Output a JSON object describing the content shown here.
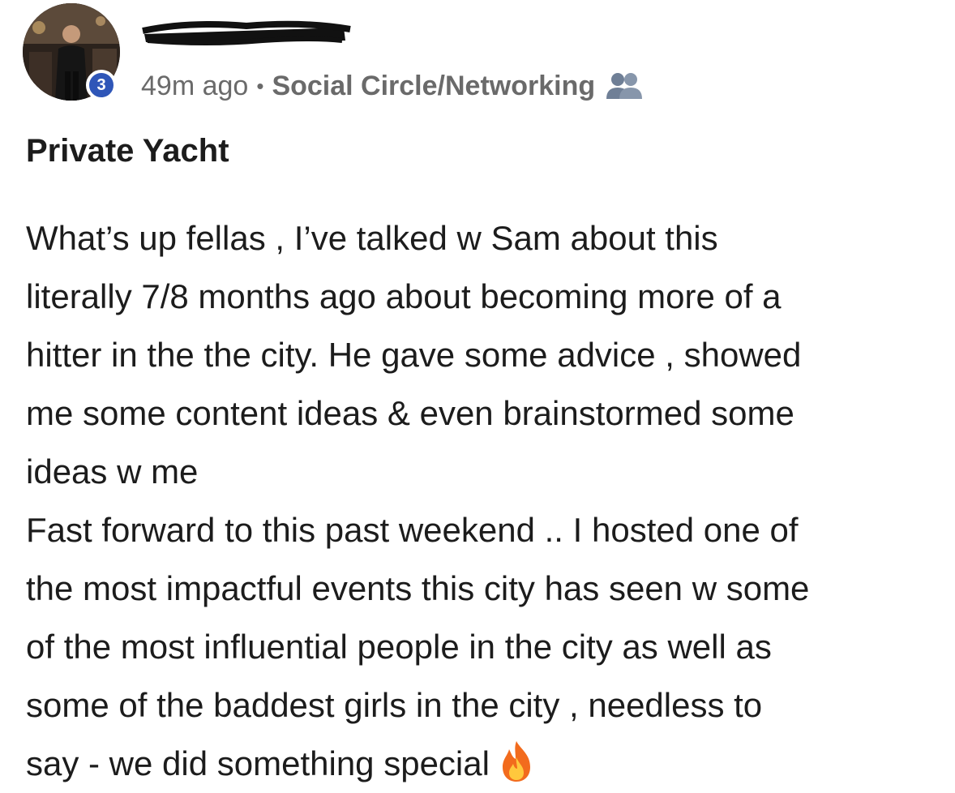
{
  "post": {
    "author": {
      "name_redacted": true,
      "badge_count": "3"
    },
    "meta": {
      "time": "49m ago",
      "separator": "•",
      "category": "Social Circle/Networking",
      "category_icon": "group-icon"
    },
    "title": "Private Yacht",
    "body_lines": [
      "What’s up fellas , I’ve talked w Sam about this",
      "literally 7/8 months ago about becoming more of a",
      "hitter in the the city. He gave some advice , showed",
      "me some content ideas & even brainstormed some",
      "ideas w me",
      "Fast forward to this past weekend .. I hosted one of",
      "the most impactful events this city has seen w some",
      "of the most influential people in the city as well as",
      "some of the baddest girls in the city , needless to",
      "say - we did something special"
    ],
    "emoji": "fire-icon"
  },
  "colors": {
    "badge": "#2f56b8",
    "meta_text": "#6a6a6a",
    "body_text": "#1c1c1c",
    "group_icon": "#6f7f96",
    "fire_outer": "#f26b1d",
    "fire_inner": "#ffc83d"
  }
}
